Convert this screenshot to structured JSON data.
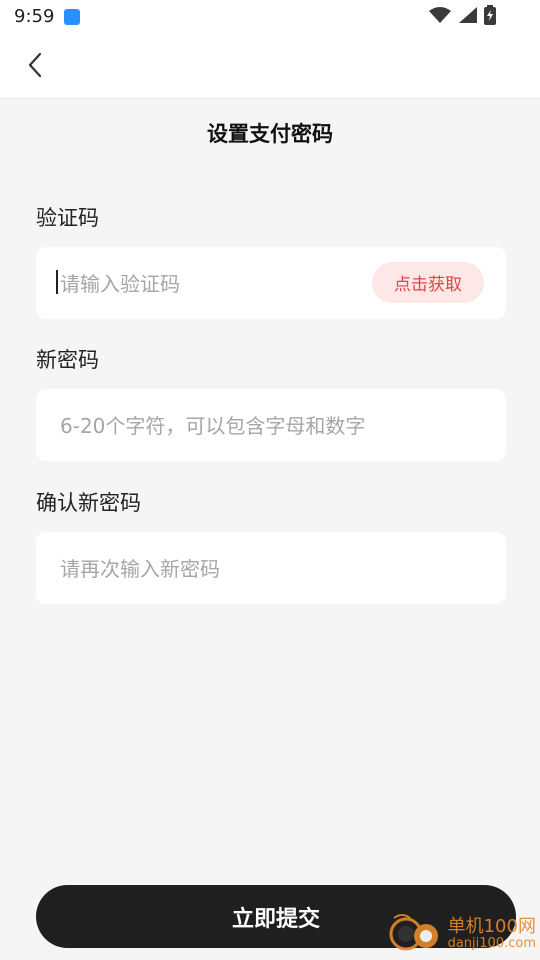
{
  "status_bar": {
    "time": "9:59",
    "icons": [
      "wifi-icon",
      "signal-icon",
      "battery-icon"
    ]
  },
  "nav": {
    "back_icon": "chevron-left-icon"
  },
  "page": {
    "title": "设置支付密码"
  },
  "form": {
    "code": {
      "label": "验证码",
      "placeholder": "请输入验证码",
      "button": "点击获取"
    },
    "new_password": {
      "label": "新密码",
      "placeholder": "6-20个字符，可以包含字母和数字"
    },
    "confirm_password": {
      "label": "确认新密码",
      "placeholder": "请再次输入新密码"
    }
  },
  "actions": {
    "submit": "立即提交"
  },
  "watermark": {
    "title": "单机100网",
    "url": "danji100.com"
  },
  "colors": {
    "background": "#f5f5f5",
    "field_bg": "#ffffff",
    "accent_red": "#e04545",
    "accent_red_bg": "#fde7e7",
    "button_dark": "#1f1f1f",
    "watermark_orange": "#e1892a"
  }
}
